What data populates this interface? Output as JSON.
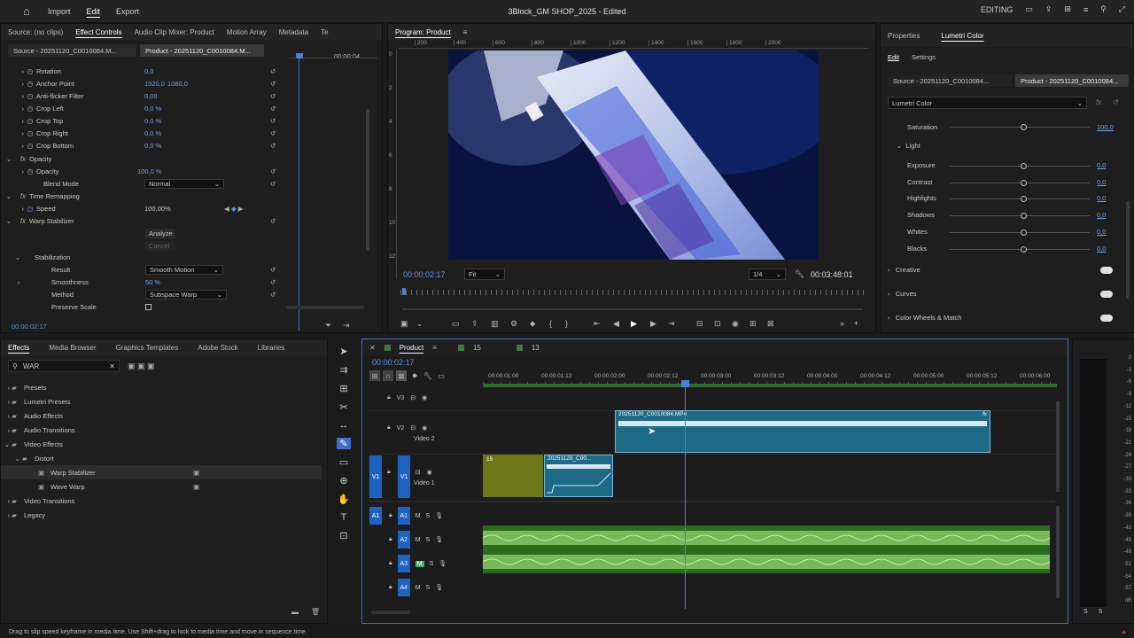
{
  "app": {
    "menu": [
      "Import",
      "Edit",
      "Export"
    ],
    "menu_active": "Edit",
    "title": "3Block_GM SHOP_2025 - Edited",
    "workspace": "EDITING"
  },
  "effect_controls": {
    "tabs": [
      "Source: (no clips)",
      "Effect Controls",
      "Audio Clip Mixer: Product",
      "Motion Array",
      "Metadata",
      "Te"
    ],
    "active_tab": "Effect Controls",
    "source_chip": "Source - 20251120_C0010084.M...",
    "product_chip": "Product - 20251120_C0010084.M...",
    "timecode_right": "00:00:04",
    "props": [
      {
        "label": "Rotation",
        "v1": "0,0",
        "v2": ""
      },
      {
        "label": "Anchor Point",
        "v1": "1920,0",
        "v2": "1080,0"
      },
      {
        "label": "Anti-flicker Filter",
        "v1": "0,00",
        "v2": ""
      },
      {
        "label": "Crop Left",
        "v1": "0,0 %",
        "v2": ""
      },
      {
        "label": "Crop Top",
        "v1": "0,0 %",
        "v2": ""
      },
      {
        "label": "Crop Right",
        "v1": "0,0 %",
        "v2": ""
      },
      {
        "label": "Crop Bottom",
        "v1": "0,0 %",
        "v2": ""
      }
    ],
    "opacity_section": "Opacity",
    "opacity_label": "Opacity",
    "opacity_value": "100,0 %",
    "blend_label": "Blend Mode",
    "blend_value": "Normal",
    "time_remap": "Time Remapping",
    "speed_label": "Speed",
    "speed_value": "100,00%",
    "warp": "Warp Stabilizer",
    "analyze": "Analyze",
    "cancel": "Cancel",
    "stabilization": "Stabilization",
    "result_label": "Result",
    "result_value": "Smooth Motion",
    "smooth_label": "Smoothness",
    "smooth_value": "50 %",
    "method_label": "Method",
    "method_value": "Subspace Warp",
    "preserve_label": "Preserve Scale",
    "timecode": "00:00:02:17"
  },
  "program": {
    "tab": "Program: Product",
    "ruler_labels": [
      "200",
      "400",
      "600",
      "800",
      "1000",
      "1200",
      "1400",
      "1600",
      "1800",
      "2000"
    ],
    "vruler_labels": [
      "0",
      "2",
      "4",
      "6",
      "8",
      "10",
      "12"
    ],
    "timecode": "00:00:02:17",
    "fit": "Fit",
    "quality": "1/4",
    "duration": "00:03:48:01"
  },
  "lumetri": {
    "tabs": [
      "Properties",
      "Lumetri Color"
    ],
    "active_tab": "Lumetri Color",
    "subtabs": [
      "Edit",
      "Settings"
    ],
    "source_chip": "Source - 20251120_C0010084...",
    "product_chip": "Product - 20251120_C0010084...",
    "effect": "Lumetri Color",
    "saturation_label": "Saturation",
    "saturation_value": "100,0",
    "light": "Light",
    "sliders": [
      {
        "label": "Exposure",
        "value": "0,0"
      },
      {
        "label": "Contrast",
        "value": "0,0"
      },
      {
        "label": "Highlights",
        "value": "0,0"
      },
      {
        "label": "Shadows",
        "value": "0,0"
      },
      {
        "label": "Whites",
        "value": "0,0"
      },
      {
        "label": "Blacks",
        "value": "0,0"
      }
    ],
    "sections": [
      "Creative",
      "Curves",
      "Color Wheels & Match"
    ]
  },
  "effects_panel": {
    "tabs": [
      "Effects",
      "Media Browser",
      "Graphics Templates",
      "Adobe Stock",
      "Libraries"
    ],
    "active_tab": "Effects",
    "search": "WAR",
    "tree": [
      {
        "label": "Presets",
        "level": 0
      },
      {
        "label": "Lumetri Presets",
        "level": 0
      },
      {
        "label": "Audio Effects",
        "level": 0
      },
      {
        "label": "Audio Transitions",
        "level": 0
      },
      {
        "label": "Video Effects",
        "level": 0
      },
      {
        "label": "Distort",
        "level": 1
      },
      {
        "label": "Warp Stabilizer",
        "level": 2
      },
      {
        "label": "Wave Warp",
        "level": 2
      },
      {
        "label": "Video Transitions",
        "level": 0
      },
      {
        "label": "Legacy",
        "level": 0
      }
    ]
  },
  "timeline": {
    "tabs": [
      "Product",
      "15",
      "13"
    ],
    "timecode": "00:00:02:17",
    "ruler": [
      "00:00:01:00",
      "00:00:01:12",
      "00:00:02:00",
      "00:00:02:12",
      "00:00:03:00",
      "00:00:03:12",
      "00:00:04:00",
      "00:00:04:12",
      "00:00:05:00",
      "00:00:05:12",
      "00:00:06:00"
    ],
    "tracks_video": [
      {
        "id": "V3",
        "name": ""
      },
      {
        "id": "V2",
        "name": "Video 2"
      },
      {
        "id": "V1",
        "name": "Video 1"
      }
    ],
    "tracks_audio": [
      "A1",
      "A2",
      "A3",
      "A4"
    ],
    "clip_v2": "20251120_C0010084.MP4",
    "clip_v1a": "15",
    "clip_v1b": "20251120_C00...",
    "fx": "fx",
    "meter_labels": [
      "0",
      "-3",
      "-6",
      "-9",
      "-12",
      "-15",
      "-18",
      "-21",
      "-24",
      "-27",
      "-30",
      "-33",
      "-36",
      "-39",
      "-42",
      "-45",
      "-48",
      "-51",
      "-54",
      "-57",
      "dB"
    ],
    "meter_ss": [
      "S",
      "S"
    ]
  },
  "status": "Drag to slip speed keyframe in media time. Use Shift+drag to lock to media time and move in sequence time."
}
